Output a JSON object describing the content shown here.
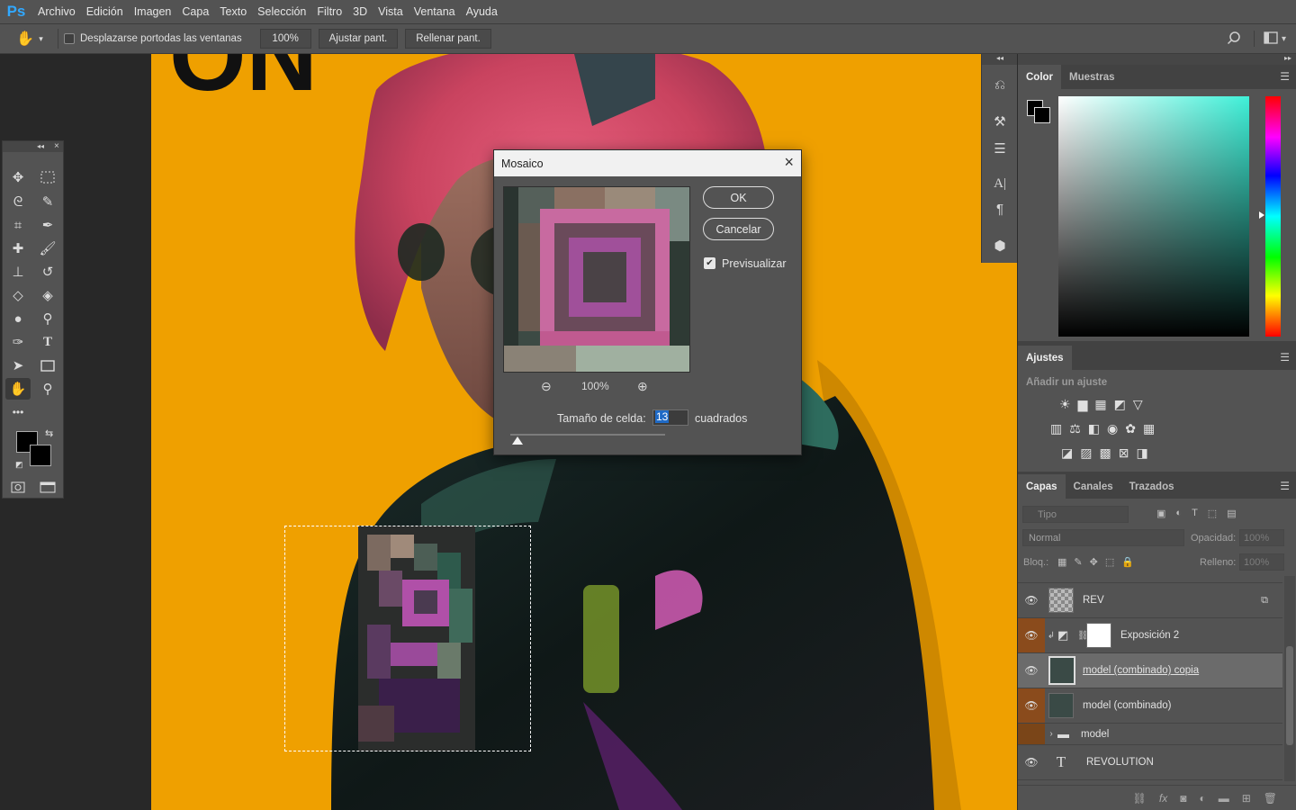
{
  "app": {
    "logo": "Ps"
  },
  "menu": [
    "Archivo",
    "Edición",
    "Imagen",
    "Capa",
    "Texto",
    "Selección",
    "Filtro",
    "3D",
    "Vista",
    "Ventana",
    "Ayuda"
  ],
  "options_bar": {
    "scroll_all_label": "Desplazarse portodas las ventanas",
    "zoom_value": "100%",
    "fit_screen": "Ajustar pant.",
    "fill_screen": "Rellenar pant."
  },
  "canvas": {
    "headline_fragment": "ON"
  },
  "dialog": {
    "title": "Mosaico",
    "ok": "OK",
    "cancel": "Cancelar",
    "preview_label": "Previsualizar",
    "preview_checked": true,
    "zoom": "100%",
    "cell_size_label": "Tamaño de celda:",
    "cell_size_value": "13",
    "cell_size_unit": "cuadrados"
  },
  "color_panel": {
    "tabs": [
      "Color",
      "Muestras"
    ],
    "foreground": "#000000",
    "background": "#000000",
    "hue_color": "#3ff0d8"
  },
  "adjustments_panel": {
    "title": "Ajustes",
    "add_label": "Añadir un ajuste"
  },
  "layers_panel": {
    "tabs": [
      "Capas",
      "Canales",
      "Trazados"
    ],
    "filter_placeholder": "Tipo",
    "blend_mode": "Normal",
    "opacity_label": "Opacidad:",
    "opacity_value": "100%",
    "lock_label": "Bloq.:",
    "fill_label": "Relleno:",
    "fill_value": "100%",
    "layers": [
      {
        "name": "REV",
        "visible": true,
        "selected": false
      },
      {
        "name": "Exposición 2",
        "visible": true,
        "selected": false
      },
      {
        "name": "model (combinado) copia",
        "visible": true,
        "selected": true
      },
      {
        "name": "model (combinado)",
        "visible": true,
        "selected": false
      },
      {
        "name": "model",
        "visible": false,
        "selected": false
      },
      {
        "name": "REVOLUTION",
        "visible": true,
        "selected": false
      }
    ]
  }
}
